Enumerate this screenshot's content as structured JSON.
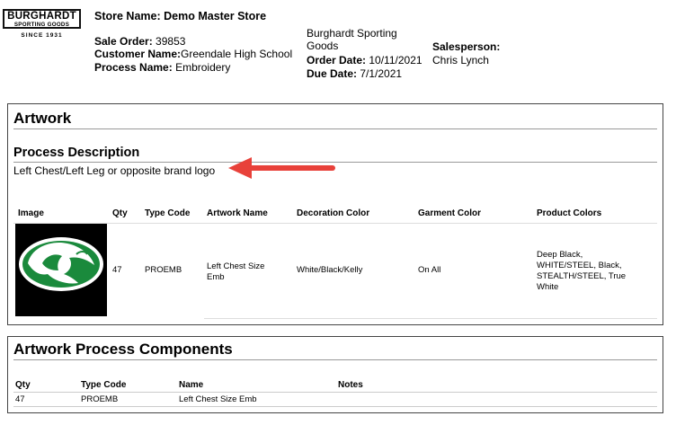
{
  "logo": {
    "name": "BURGHARDT",
    "sub": "SPORTING GOODS",
    "since": "SINCE 1931"
  },
  "header": {
    "store_label": "Store Name:",
    "store_value": "Demo Master Store",
    "sale_order_label": "Sale Order:",
    "sale_order_value": "39853",
    "customer_label": "Customer Name:",
    "customer_value": "Greendale High School",
    "process_label": "Process Name:",
    "process_value": "Embroidery",
    "company_name": "Burghardt Sporting Goods",
    "order_date_label": "Order Date:",
    "order_date_value": "10/11/2021",
    "due_date_label": "Due Date:",
    "due_date_value": "7/1/2021",
    "salesperson_label": "Salesperson:",
    "salesperson_value": "Chris Lynch"
  },
  "artwork": {
    "title": "Artwork",
    "process_description_title": "Process Description",
    "process_description": "Left Chest/Left Leg or opposite brand logo",
    "columns": [
      "Image",
      "Qty",
      "Type Code",
      "Artwork Name",
      "Decoration Color",
      "Garment Color",
      "Product Colors"
    ],
    "row": {
      "qty": "47",
      "type_code": "PROEMB",
      "artwork_name": "Left Chest Size Emb",
      "decoration_color": "White/Black/Kelly",
      "garment_color": "On All",
      "product_colors": "Deep Black, WHITE/STEEL, Black, STEALTH/STEEL, True White"
    },
    "logo_colors": {
      "background": "#000000",
      "green": "#1a8a3c",
      "white": "#ffffff"
    }
  },
  "components": {
    "title": "Artwork Process Components",
    "columns": [
      "Qty",
      "Type Code",
      "Name",
      "Notes"
    ],
    "row": {
      "qty": "47",
      "type_code": "PROEMB",
      "name": "Left Chest Size Emb",
      "notes": ""
    }
  },
  "annotation": {
    "arrow_color": "#e8413a"
  }
}
